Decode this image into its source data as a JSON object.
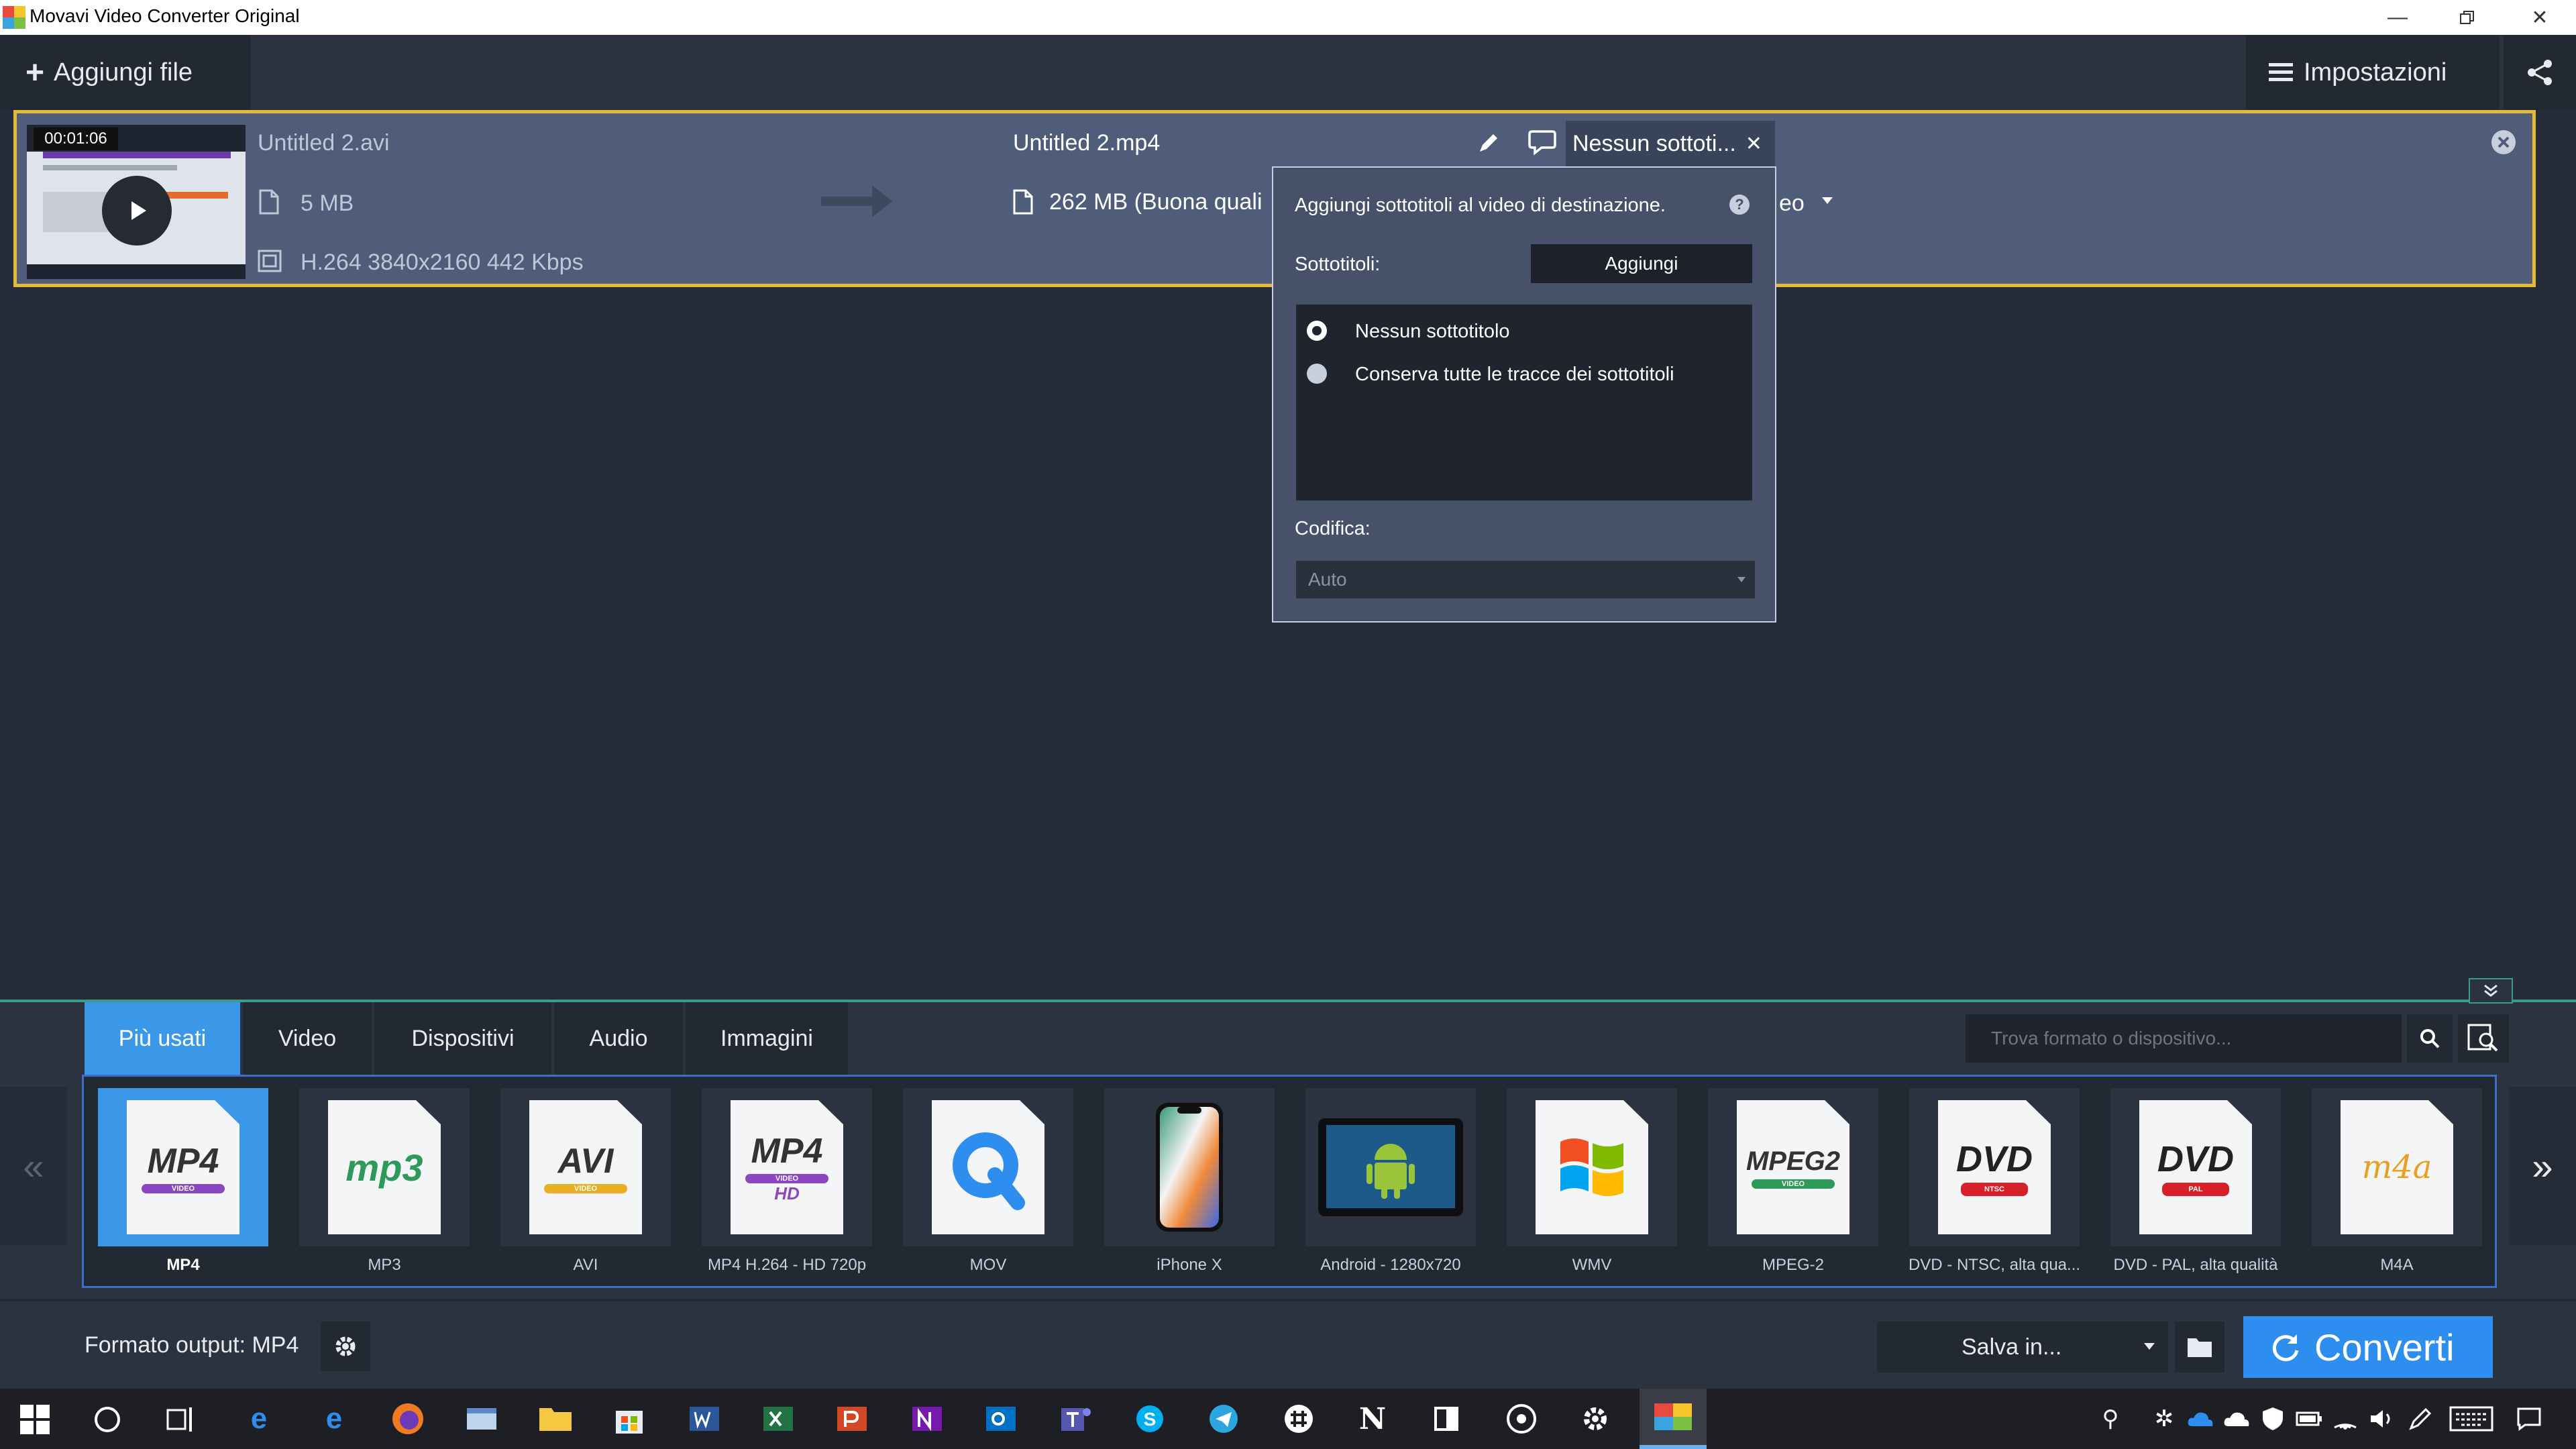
{
  "window": {
    "title": "Movavi Video Converter Original"
  },
  "toolbar": {
    "add_files_label": "Aggiungi file",
    "settings_label": "Impostazioni"
  },
  "file": {
    "timestamp": "00:01:06",
    "source_name": "Untitled 2.avi",
    "source_size": "5 MB",
    "source_info": "H.264 3840x2160 442 Kbps",
    "output_name": "Untitled 2.mp4",
    "output_size": "262 MB (Buona quali",
    "subtitle_selected": "Nessun sottoti...",
    "audio_partial": "eo"
  },
  "subtitles_popup": {
    "description": "Aggiungi sottotitoli al video di destinazione.",
    "help": "?",
    "subtitles_label": "Sottotitoli:",
    "add_button": "Aggiungi",
    "options": [
      {
        "label": "Nessun sottotitolo",
        "selected": true
      },
      {
        "label": "Conserva tutte le tracce dei sottotitoli",
        "selected": false
      }
    ],
    "encoding_label": "Codifica:",
    "encoding_value": "Auto"
  },
  "format_tabs": [
    {
      "label": "Più usati",
      "active": true
    },
    {
      "label": "Video",
      "active": false
    },
    {
      "label": "Dispositivi",
      "active": false
    },
    {
      "label": "Audio",
      "active": false
    },
    {
      "label": "Immagini",
      "active": false
    }
  ],
  "search": {
    "placeholder": "Trova formato o dispositivo..."
  },
  "formats": [
    {
      "label": "MP4",
      "icon": "mp4-icon",
      "art": "MP4",
      "band": "VIDEO",
      "band_color": "#8b47c2"
    },
    {
      "label": "MP3",
      "icon": "mp3-icon",
      "art": "mp3",
      "band": "",
      "band_color": "#2d9a5a"
    },
    {
      "label": "AVI",
      "icon": "avi-icon",
      "art": "AVI",
      "band": "VIDEO",
      "band_color": "#e8b020"
    },
    {
      "label": "MP4 H.264 - HD 720p",
      "icon": "mp4-hd-icon",
      "art": "MP4",
      "band": "VIDEO",
      "band_color": "#8b47c2",
      "extra": "HD"
    },
    {
      "label": "MOV",
      "icon": "quicktime-icon",
      "art": "Q",
      "band": "",
      "band_color": "#2e8ef0"
    },
    {
      "label": "iPhone X",
      "icon": "iphone-icon"
    },
    {
      "label": "Android - 1280x720",
      "icon": "android-tablet-icon"
    },
    {
      "label": "WMV",
      "icon": "windows-media-icon"
    },
    {
      "label": "MPEG-2",
      "icon": "mpeg2-icon",
      "art": "MPEG2",
      "band": "VIDEO",
      "band_color": "#2d9a5a"
    },
    {
      "label": "DVD - NTSC, alta qua...",
      "icon": "dvd-ntsc-icon",
      "art": "DVD",
      "band": "NTSC",
      "band_color": "#d8202a"
    },
    {
      "label": "DVD - PAL, alta qualità",
      "icon": "dvd-pal-icon",
      "art": "DVD",
      "band": "PAL",
      "band_color": "#d8202a"
    },
    {
      "label": "M4A",
      "icon": "m4a-icon",
      "art": "m4a",
      "band": "",
      "band_color": "#e8a020"
    }
  ],
  "footer": {
    "output_format": "Formato output: MP4",
    "save_in": "Salva in...",
    "convert_label": "Converti"
  },
  "colors": {
    "accent": "#3b98e8",
    "file_highlight": "#e5b93a",
    "background": "#262c37"
  }
}
